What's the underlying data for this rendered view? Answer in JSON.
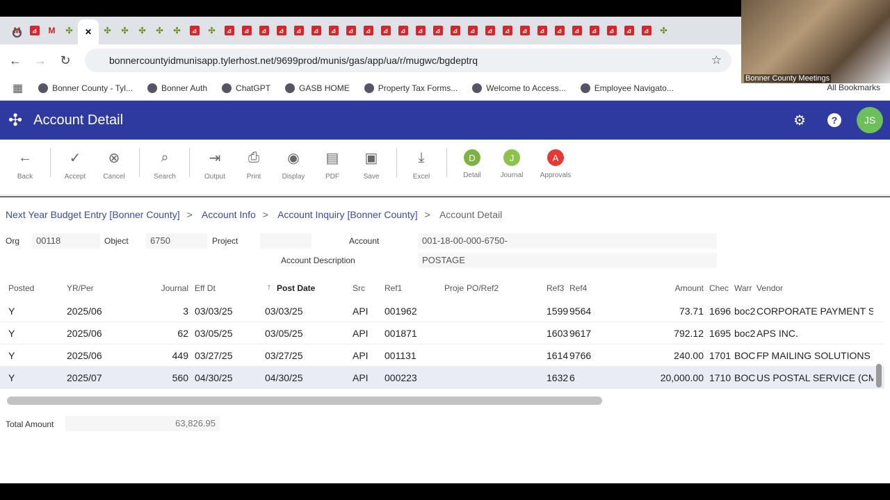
{
  "browser": {
    "tabs": [
      "gmail",
      "chrome",
      "pdf",
      "gmail",
      "chrome",
      "chrome",
      "tyler",
      "close",
      "tyler",
      "tyler",
      "tyler",
      "tyler",
      "tyler",
      "pdf",
      "tyler",
      "pdf",
      "pdf",
      "pdf",
      "pdf",
      "pdf",
      "pdf",
      "pdf",
      "pdf",
      "pdf",
      "pdf",
      "pdf",
      "pdf",
      "pdf",
      "pdf",
      "pdf",
      "pdf",
      "pdf",
      "pdf",
      "pdf",
      "pdf",
      "pdf",
      "pdf",
      "pdf",
      "pdf",
      "pdf",
      "tyler",
      "chrome"
    ],
    "url": "bonnercountyidmunisapp.tylerhost.net/9699prod/munis/gas/app/ua/r/mugwc/bgdeptrq",
    "bookmarks": [
      "Bonner County - Tyl...",
      "Bonner Auth",
      "ChatGPT",
      "GASB HOME",
      "Property Tax Forms...",
      "Welcome to Access...",
      "Employee Navigato..."
    ],
    "all_bookmarks": "All Bookmarks"
  },
  "webcam": {
    "caption": "Bonner County Meetings"
  },
  "app": {
    "title": "Account Detail",
    "avatar": "JS",
    "accent": "#2e3a9f"
  },
  "toolbar": [
    {
      "label": "Back",
      "icon": "←"
    },
    {
      "label": "Accept",
      "icon": "✓"
    },
    {
      "label": "Cancel",
      "icon": "⊗"
    },
    {
      "label": "Search",
      "icon": "⌕"
    },
    {
      "label": "Output",
      "icon": "⇥"
    },
    {
      "label": "Print",
      "icon": "⎙"
    },
    {
      "label": "Display",
      "icon": "◉"
    },
    {
      "label": "PDF",
      "icon": "▤"
    },
    {
      "label": "Save",
      "icon": "▣"
    },
    {
      "label": "Excel",
      "icon": "⤓"
    },
    {
      "label": "Detail",
      "letter": "D",
      "color": "#7cb342"
    },
    {
      "label": "Journal",
      "letter": "J",
      "color": "#8bc34a"
    },
    {
      "label": "Approvals",
      "letter": "A",
      "color": "#e53935"
    }
  ],
  "breadcrumb": [
    "Next Year Budget Entry [Bonner County]",
    "Account Info",
    "Account Inquiry [Bonner County]",
    "Account Detail"
  ],
  "form": {
    "org_label": "Org",
    "org": "00118",
    "object_label": "Object",
    "object": "6750",
    "project_label": "Project",
    "project": "",
    "account_label": "Account",
    "account": "001-18-00-000-6750-",
    "desc_label": "Account Description",
    "desc": "POSTAGE"
  },
  "grid": {
    "columns": [
      "Posted",
      "YR/Per",
      "Journal",
      "Eff Dt",
      "Post Date",
      "Src",
      "Ref1",
      "Proje",
      "PO/Ref2",
      "Ref3",
      "Ref4",
      "Amount",
      "Chec",
      "Warr",
      "Vendor"
    ],
    "rows": [
      [
        "Y",
        "2025/06",
        "3",
        "03/03/25",
        "03/03/25",
        "API",
        "001962",
        "",
        "",
        "1599",
        "9564",
        "73.71",
        "1696",
        "boc2",
        "CORPORATE PAYMENT S"
      ],
      [
        "Y",
        "2025/06",
        "62",
        "03/05/25",
        "03/05/25",
        "API",
        "001871",
        "",
        "",
        "1603",
        "9617",
        "792.12",
        "1695",
        "boc2",
        "APS INC."
      ],
      [
        "Y",
        "2025/06",
        "449",
        "03/27/25",
        "03/27/25",
        "API",
        "001131",
        "",
        "",
        "1614",
        "9766",
        "240.00",
        "1701",
        "BOC",
        "FP MAILING SOLUTIONS"
      ],
      [
        "Y",
        "2025/07",
        "560",
        "04/30/25",
        "04/30/25",
        "API",
        "000223",
        "",
        "",
        "1632",
        "6",
        "20,000.00",
        "1710",
        "BOC",
        "US POSTAL SERVICE (CM"
      ]
    ]
  },
  "total": {
    "label": "Total Amount",
    "value": "63,826.95"
  }
}
